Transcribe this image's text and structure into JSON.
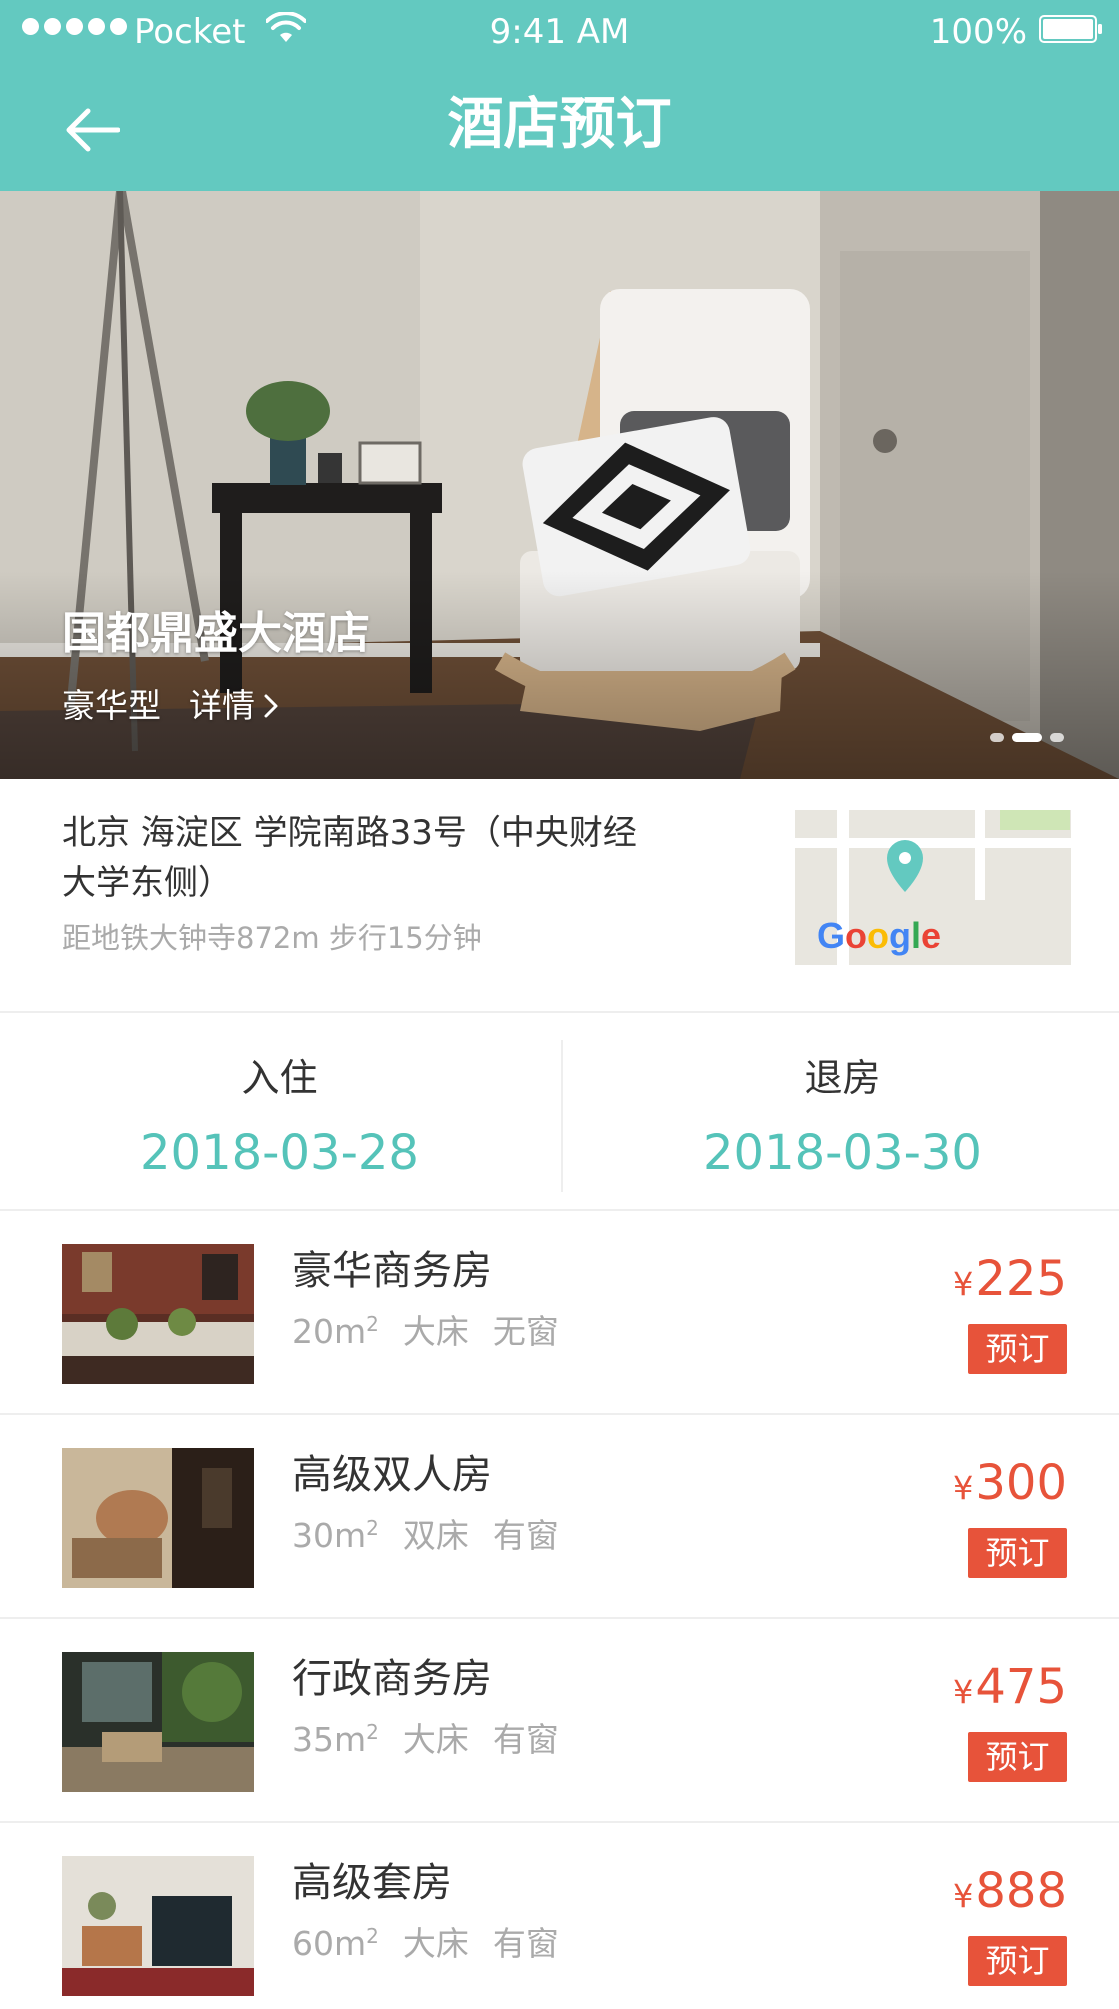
{
  "status_bar": {
    "carrier": "Pocket",
    "time": "9:41 AM",
    "battery": "100%"
  },
  "nav": {
    "title": "酒店预订",
    "back_icon": "arrow-left-icon"
  },
  "colors": {
    "brand_teal": "#63c9c0",
    "date_teal": "#55c3b9",
    "price_red": "#e7533a"
  },
  "hotel": {
    "name": "国都鼎盛大酒店",
    "type": "豪华型",
    "details_label": "详情",
    "gallery_pages": 3,
    "gallery_active_index": 2
  },
  "address": {
    "text": "北京 海淀区 学院南路33号（中央财经大学东侧）",
    "subway": "距地铁大钟寺872m 步行15分钟",
    "map_logo": "Google"
  },
  "stay": {
    "checkin_label": "入住",
    "checkin_date": "2018-03-28",
    "checkout_label": "退房",
    "checkout_date": "2018-03-30"
  },
  "rooms": [
    {
      "name": "豪华商务房",
      "area": "20m",
      "area_sup": "2",
      "bed": "大床",
      "window": "无窗",
      "currency": "¥",
      "price": "225",
      "book_label": "预订"
    },
    {
      "name": "高级双人房",
      "area": "30m",
      "area_sup": "2",
      "bed": "双床",
      "window": "有窗",
      "currency": "¥",
      "price": "300",
      "book_label": "预订"
    },
    {
      "name": "行政商务房",
      "area": "35m",
      "area_sup": "2",
      "bed": "大床",
      "window": "有窗",
      "currency": "¥",
      "price": "475",
      "book_label": "预订"
    },
    {
      "name": "高级套房",
      "area": "60m",
      "area_sup": "2",
      "bed": "大床",
      "window": "有窗",
      "currency": "¥",
      "price": "888",
      "book_label": "预订"
    }
  ]
}
